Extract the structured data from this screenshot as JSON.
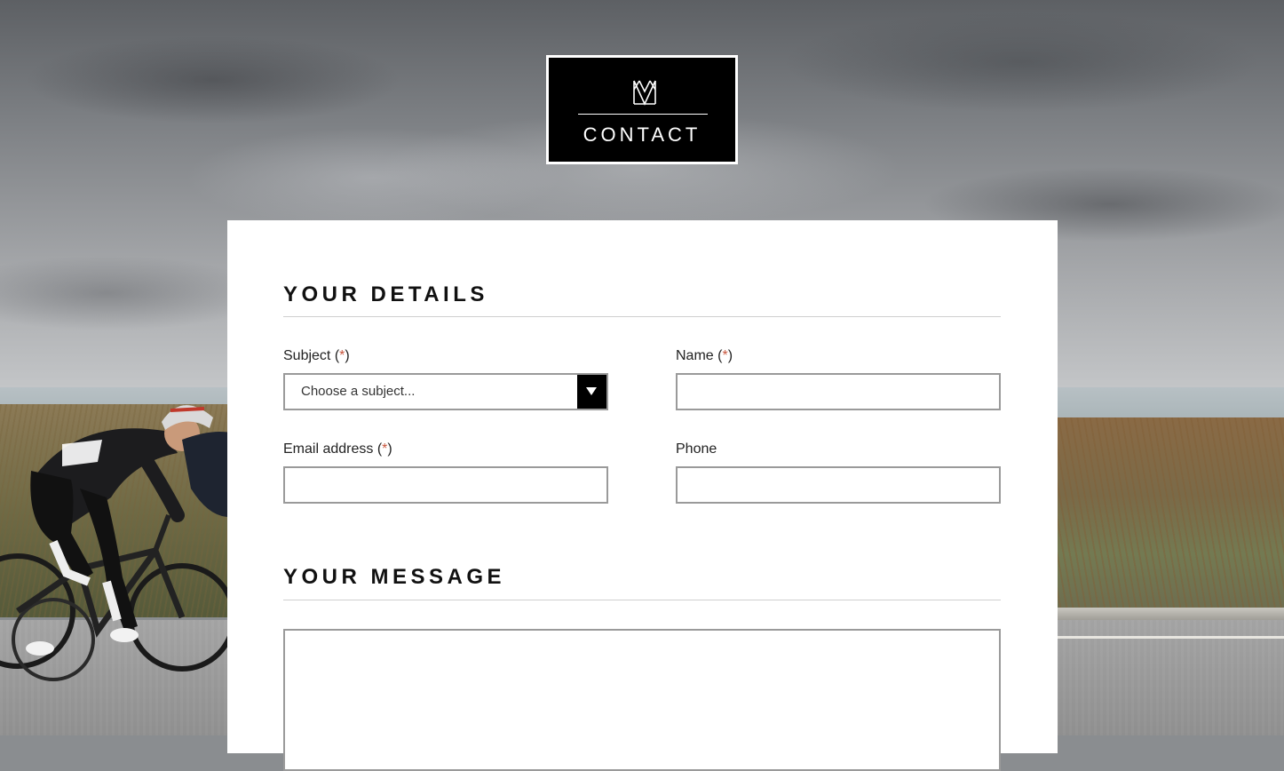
{
  "badge": {
    "title": "CONTACT",
    "logo_icon": "crown-monogram-icon"
  },
  "details_section": {
    "title": "YOUR DETAILS",
    "subject": {
      "label": "Subject (",
      "required_mark": "*",
      "label_close": ")",
      "selected_value": "Choose a subject...",
      "arrow_icon": "caret-down-icon"
    },
    "name": {
      "label": "Name (",
      "required_mark": "*",
      "label_close": ")",
      "value": ""
    },
    "email": {
      "label": "Email address (",
      "required_mark": "*",
      "label_close": ")",
      "value": ""
    },
    "phone": {
      "label": "Phone",
      "value": ""
    }
  },
  "message_section": {
    "title": "YOUR MESSAGE",
    "value": ""
  },
  "colors": {
    "required_mark": "#c8553d",
    "badge_bg": "#000000",
    "card_bg": "#ffffff"
  }
}
